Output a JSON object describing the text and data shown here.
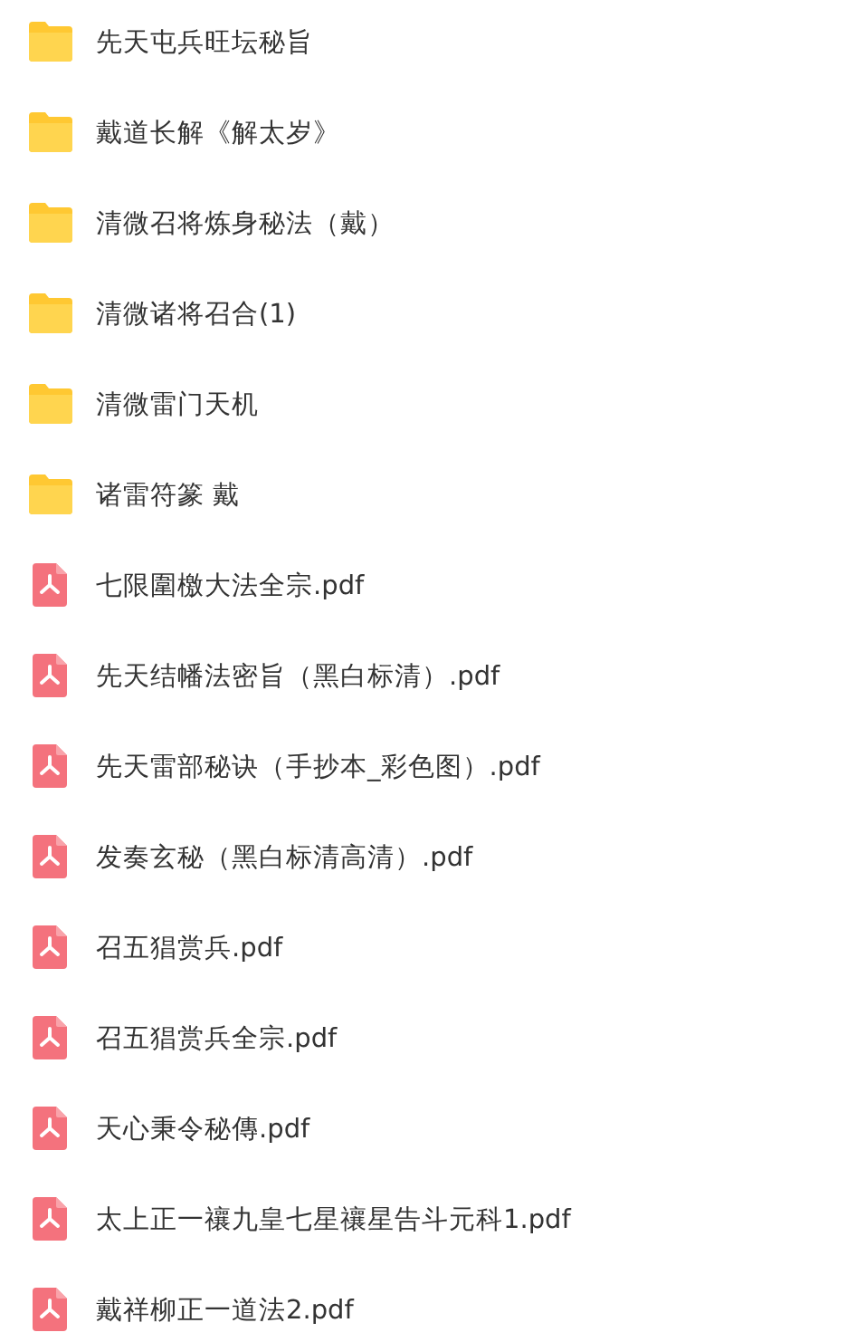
{
  "files": [
    {
      "kind": "folder",
      "name": "先天屯兵旺坛秘旨"
    },
    {
      "kind": "folder",
      "name": "戴道长解《解太岁》"
    },
    {
      "kind": "folder",
      "name": "清微召将炼身秘法（戴）"
    },
    {
      "kind": "folder",
      "name": "清微诸将召合(1)"
    },
    {
      "kind": "folder",
      "name": "清微雷门天机"
    },
    {
      "kind": "folder",
      "name": "诸雷符篆 戴"
    },
    {
      "kind": "pdf",
      "name": "七限圍檄大法全宗.pdf"
    },
    {
      "kind": "pdf",
      "name": "先天结幡法密旨（黑白标清）.pdf"
    },
    {
      "kind": "pdf",
      "name": "先天雷部秘诀（手抄本_彩色图）.pdf"
    },
    {
      "kind": "pdf",
      "name": "发奏玄秘（黑白标清高清）.pdf"
    },
    {
      "kind": "pdf",
      "name": "召五猖赏兵.pdf"
    },
    {
      "kind": "pdf",
      "name": "召五猖赏兵全宗.pdf"
    },
    {
      "kind": "pdf",
      "name": "天心秉令秘傳.pdf"
    },
    {
      "kind": "pdf",
      "name": "太上正一禳九皇七星禳星告斗元科1.pdf"
    },
    {
      "kind": "pdf",
      "name": "戴祥柳正一道法2.pdf"
    }
  ]
}
